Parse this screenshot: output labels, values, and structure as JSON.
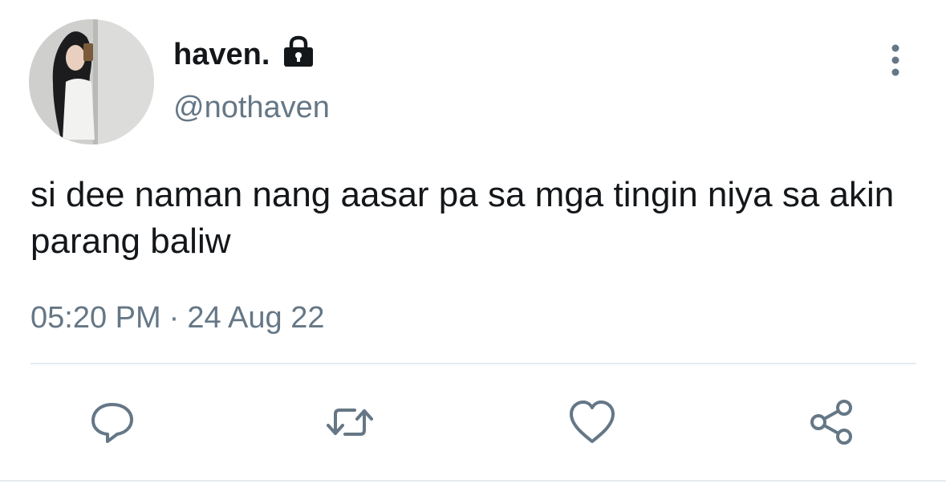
{
  "user": {
    "display_name": "haven.",
    "handle": "@nothaven",
    "protected_icon": "lock-icon",
    "avatar_icon": "avatar-photo"
  },
  "tweet": {
    "text": "si dee naman nang aasar pa sa mga tingin niya sa akin parang baliw",
    "time": "05:20 PM",
    "separator": "·",
    "date": "24 Aug 22"
  },
  "actions": {
    "reply_icon": "reply-icon",
    "retweet_icon": "retweet-icon",
    "like_icon": "heart-icon",
    "share_icon": "share-icon",
    "more_icon": "more-vertical-icon"
  },
  "colors": {
    "text": "#14171a",
    "secondary": "#657786",
    "icon": "#657786",
    "divider": "#e6ecf0"
  }
}
